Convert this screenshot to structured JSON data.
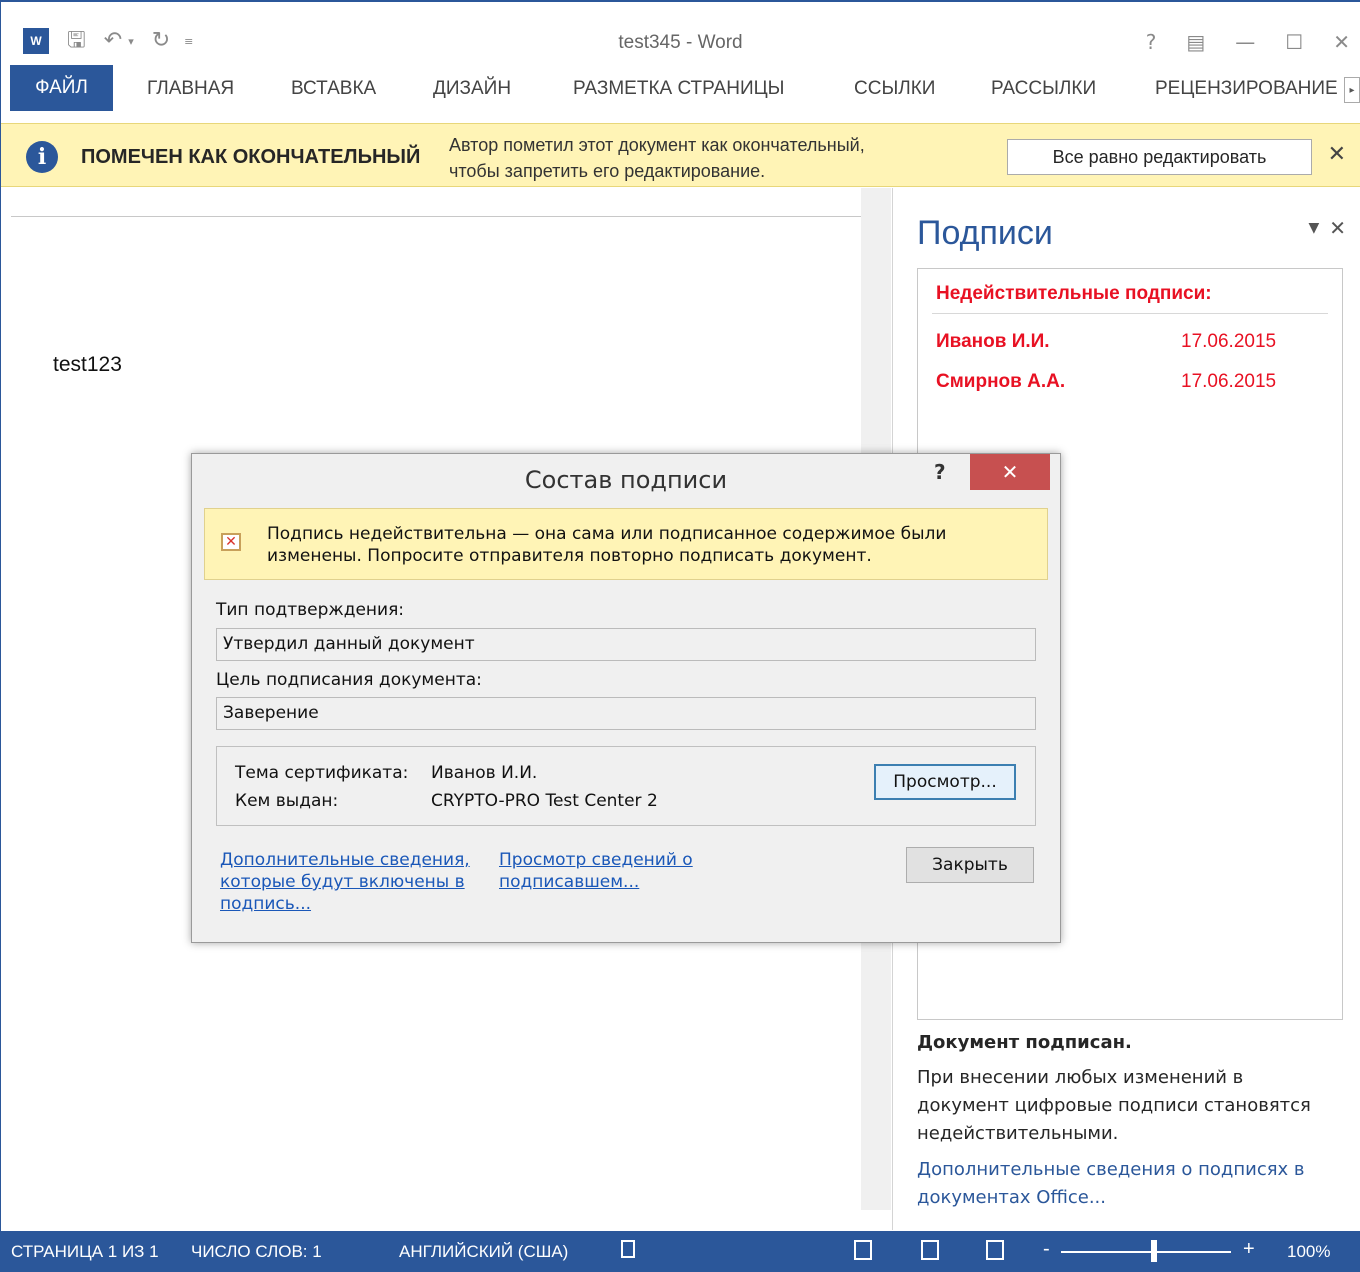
{
  "window": {
    "title": "test345 - Word",
    "app_icon_label": "W"
  },
  "quick_access": {
    "save": "save-icon",
    "undo": "undo-icon",
    "redo": "redo-icon",
    "customize": "customize-icon"
  },
  "window_controls": [
    "?",
    "restore-ribbon-icon",
    "minimize-icon",
    "maximize-icon",
    "close-icon"
  ],
  "ribbon": {
    "tabs": [
      "ФАЙЛ",
      "ГЛАВНАЯ",
      "ВСТАВКА",
      "ДИЗАЙН",
      "РАЗМЕТКА СТРАНИЦЫ",
      "ССЫЛКИ",
      "РАССЫЛКИ",
      "РЕЦЕНЗИРОВАНИЕ"
    ]
  },
  "message_bar": {
    "title": "ПОМЕЧЕН КАК ОКОНЧАТЕЛЬНЫЙ",
    "text_line1": "Автор пометил этот документ как окончательный,",
    "text_line2": "чтобы запретить его редактирование.",
    "button": "Все равно редактировать",
    "close": "✕"
  },
  "document": {
    "text": "test123"
  },
  "signatures_pane": {
    "title": "Подписи",
    "invalid_header": "Недействительные подписи:",
    "signatures": [
      {
        "name": "Иванов И.И.",
        "date": "17.06.2015"
      },
      {
        "name": "Смирнов А.А.",
        "date": "17.06.2015"
      }
    ],
    "info_title": "Документ подписан.",
    "info_text": "При внесении любых изменений в документ цифровые подписи становятся недействительными.",
    "link": "Дополнительные сведения о подписях в документах Office..."
  },
  "dialog": {
    "title": "Состав подписи",
    "help": "?",
    "close": "✕",
    "warning": "Подпись недействительна — она сама или подписанное содержимое были изменены. Попросите отправителя повторно подписать документ.",
    "type_label": "Тип подтверждения:",
    "type_value": "Утвердил данный документ",
    "purpose_label": "Цель подписания документа:",
    "purpose_value": "Заверение",
    "cert_subject_label": "Тема сертификата:",
    "cert_subject_value": "Иванов И.И.",
    "cert_issuer_label": "Кем выдан:",
    "cert_issuer_value": "CRYPTO-PRO Test Center 2",
    "view_button": "Просмотр...",
    "link_additional": "Дополнительные сведения, которые будут включены в подпись...",
    "link_signer": "Просмотр сведений о подписавшем...",
    "close_button": "Закрыть"
  },
  "status_bar": {
    "page": "СТРАНИЦА 1 ИЗ 1",
    "words": "ЧИСЛО СЛОВ: 1",
    "language": "АНГЛИЙСКИЙ (США)",
    "zoom_minus": "-",
    "zoom_plus": "+",
    "zoom": "100%"
  }
}
